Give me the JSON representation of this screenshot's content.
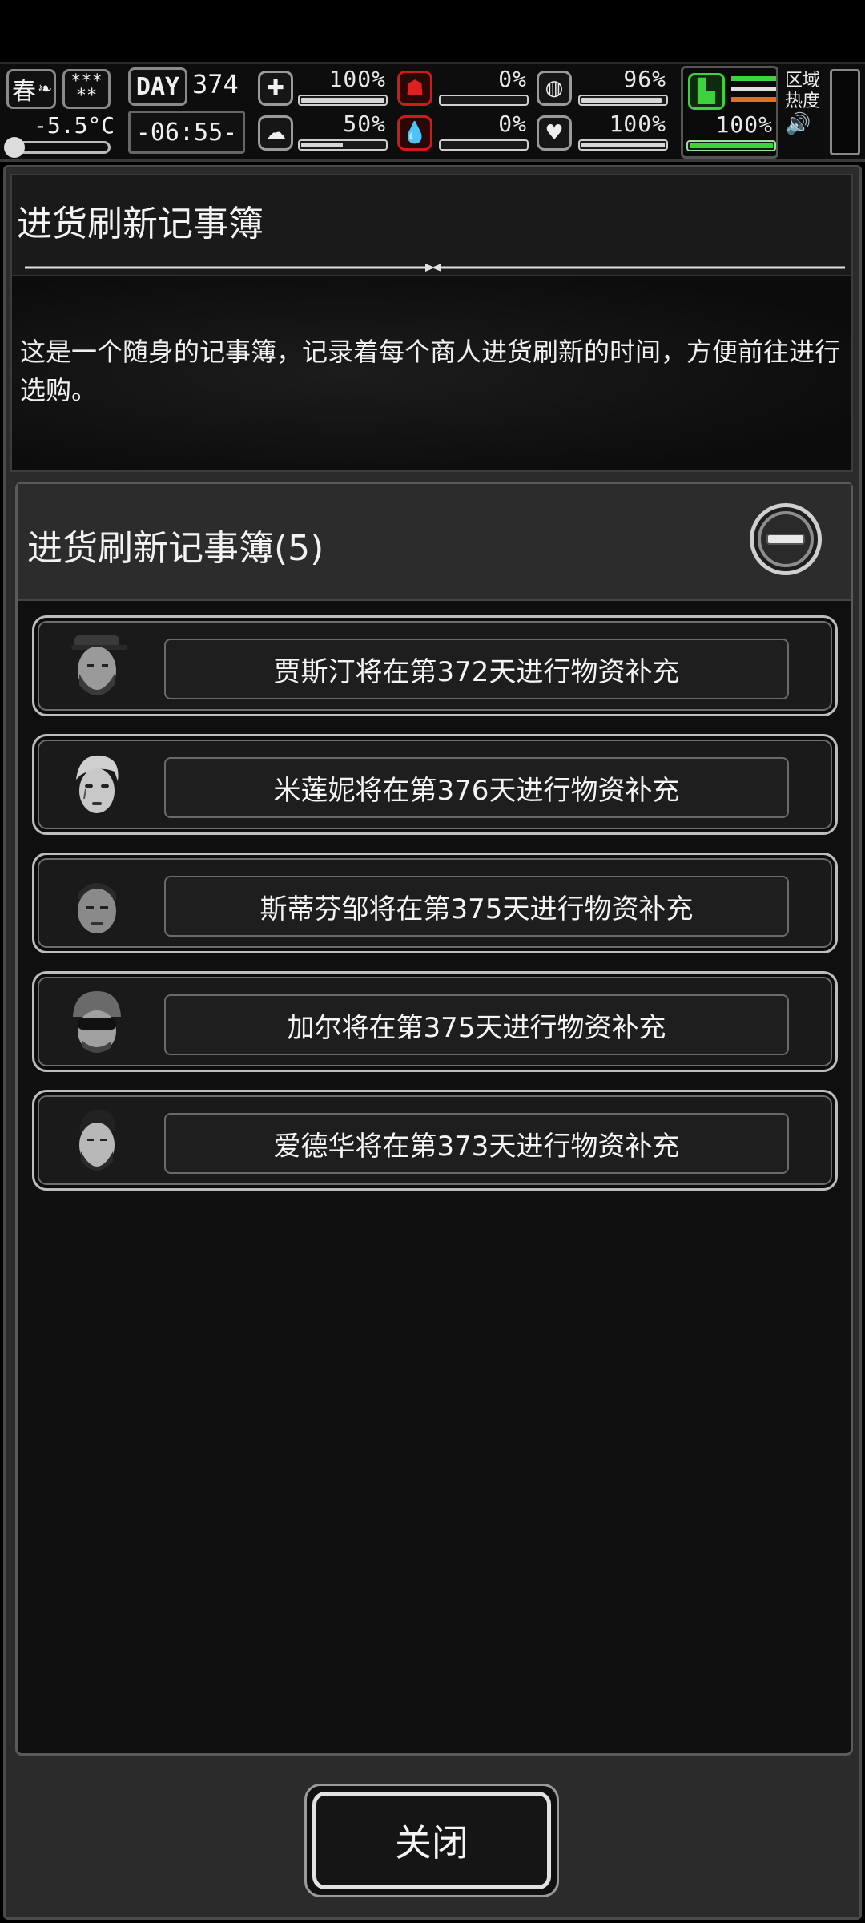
{
  "hud": {
    "season": "春",
    "weather_icon": "snow-icon",
    "temperature": "-5.5°C",
    "day_label": "DAY",
    "day_number": "374",
    "time": "-06:55-",
    "stats": {
      "health": {
        "value": "100%",
        "level": 100,
        "icon": "medkit-icon"
      },
      "hunger": {
        "value": "0%",
        "level": 0,
        "icon": "stomach-icon",
        "color": "#d11a1a"
      },
      "thirst": {
        "value": "96%",
        "level": 96,
        "icon": "water-bottle-icon"
      },
      "mental": {
        "value": "50%",
        "level": 50,
        "icon": "brain-icon"
      },
      "bleeding": {
        "value": "0%",
        "level": 0,
        "icon": "blood-drop-icon",
        "color": "#d11a1a"
      },
      "mood": {
        "value": "100%",
        "level": 100,
        "icon": "heart-icon"
      },
      "stamina": {
        "value": "100%",
        "level": 100,
        "icon": "boot-icon",
        "color": "#3fd23f"
      }
    },
    "zone_heat_label_1": "区域",
    "zone_heat_label_2": "热度"
  },
  "panel": {
    "title": "进货刷新记事簿",
    "description": "这是一个随身的记事簿，记录着每个商人进货刷新的时间，方便前往进行选购。"
  },
  "list": {
    "title": "进货刷新记事簿(5)",
    "items": [
      {
        "text": "贾斯汀将在第372天进行物资补充",
        "avatar": "bearded-man-cap-avatar"
      },
      {
        "text": "米莲妮将在第376天进行物资补充",
        "avatar": "woman-short-hair-avatar"
      },
      {
        "text": "斯蒂芬邹将在第375天进行物资补充",
        "avatar": "man-buzzcut-avatar"
      },
      {
        "text": "加尔将在第375天进行物资补充",
        "avatar": "man-helmet-goggles-avatar"
      },
      {
        "text": "爱德华将在第373天进行物资补充",
        "avatar": "bearded-man-avatar"
      }
    ]
  },
  "buttons": {
    "close_label": "关闭"
  },
  "colors": {
    "background": "#000000",
    "panel": "#2b2b2b",
    "accent_red": "#d11a1a",
    "accent_green": "#3fd23f",
    "accent_orange": "#e07020"
  }
}
